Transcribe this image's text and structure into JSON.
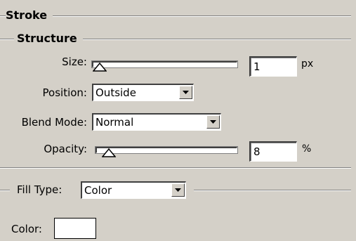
{
  "stroke": {
    "title": "Stroke"
  },
  "structure": {
    "title": "Structure",
    "size": {
      "label": "Size:",
      "value": "1",
      "unit": "px",
      "slider_fraction": 0.0
    },
    "position": {
      "label": "Position:",
      "value": "Outside"
    },
    "blend_mode": {
      "label": "Blend Mode:",
      "value": "Normal"
    },
    "opacity": {
      "label": "Opacity:",
      "value": "8",
      "unit": "%",
      "slider_fraction": 0.08
    }
  },
  "fill": {
    "type_label": "Fill Type:",
    "type_value": "Color",
    "color_label": "Color:",
    "color_value": "#ffffff"
  },
  "icons": {
    "dropdown": "chevron-down-icon",
    "slider_thumb": "slider-thumb-icon"
  }
}
